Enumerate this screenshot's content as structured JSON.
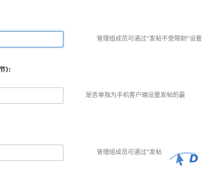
{
  "settings_form": {
    "rows": [
      {
        "input_value": "",
        "focused": true,
        "hint": "管理组成员可通过\"发帖不受限制\"设置"
      },
      {
        "label": "节):",
        "input_value": "",
        "focused": false,
        "hint": "是否单独为手机客户端设置发帖的最"
      },
      {
        "input_value": "",
        "focused": false,
        "hint": "管理组成员可通过\"发帖"
      }
    ]
  },
  "watermark": {
    "text": "D",
    "icon": "cursor-arrow-icon",
    "colors": {
      "primary": "#2e6fc0",
      "secondary": "#9dc3ea"
    }
  }
}
